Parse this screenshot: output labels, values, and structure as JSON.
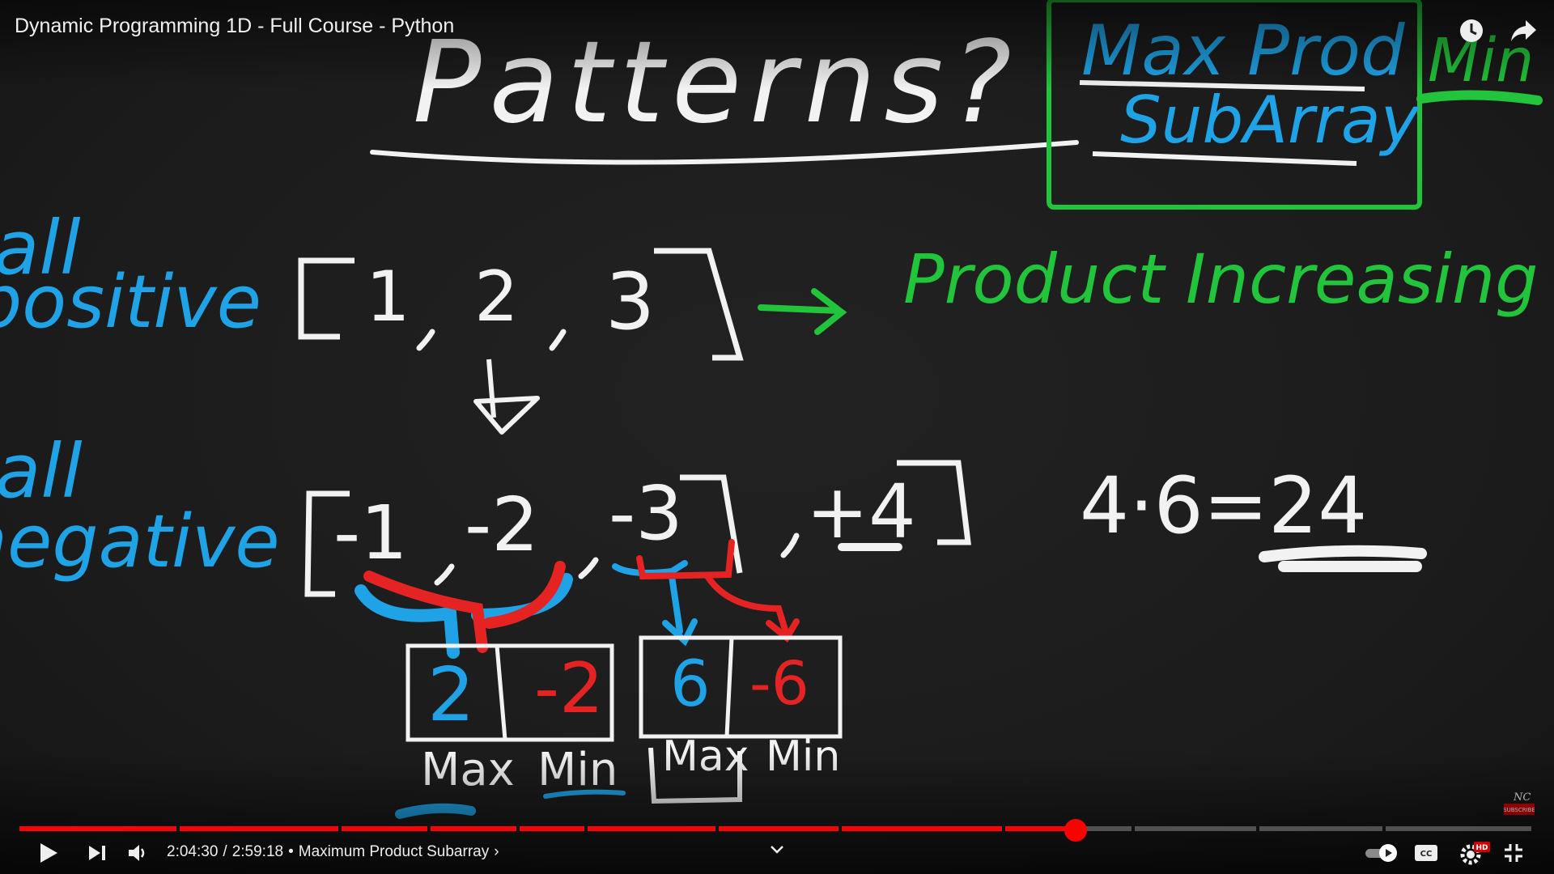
{
  "player": {
    "title": "Dynamic Programming 1D - Full Course - Python",
    "progress_fraction": 0.697,
    "current_time": "2:04:30",
    "duration": "2:59:18",
    "separator": "/",
    "bullet": "•",
    "chapter": "Maximum Product Subarray",
    "chapter_arrow": "›",
    "accent_color": "#ff0000"
  },
  "icons": {
    "watch_later": "clock-icon",
    "share": "share-icon",
    "play": "play-icon",
    "next": "next-icon",
    "volume": "volume-icon",
    "expand": "chevron-down-icon",
    "autoplay": "autoplay-toggle",
    "captions": "cc-icon",
    "settings": "gear-icon",
    "exit_fullscreen": "exit-fullscreen-icon"
  },
  "badges": {
    "settings_hd": "HD",
    "subscribe": "SUBSCRIBE",
    "channel_mark": "NC"
  },
  "board": {
    "heading": "Patterns?",
    "box_title_line1": "Max Prod",
    "box_title_line2": "SubArray",
    "min_note": "Min",
    "all_positive_1": "all",
    "all_positive_2": "positive",
    "all_negative_1": "all",
    "all_negative_2": "negative",
    "pos_array_open": "[",
    "pos_array_1": "1",
    "pos_array_2": "2",
    "pos_array_3": "3",
    "pos_array_close": "]",
    "product_increasing": "Product Increasing",
    "neg_array_open": "[",
    "neg_array_1": "-1",
    "neg_array_2": "-2",
    "neg_array_3": "-3",
    "neg_array_4": "+4",
    "neg_array_close": "]",
    "equation": "4·6=24",
    "cell_max_a": "2",
    "cell_min_a": "-2",
    "cell_max_b": "6",
    "cell_min_b": "-6",
    "label_max_a": "Max",
    "label_min_a": "Min",
    "label_max_b": "Max",
    "label_min_b": "Min",
    "colors": {
      "white": "#f2f2f2",
      "blue": "#1fa3e6",
      "green": "#21c43a",
      "red": "#e52323"
    }
  }
}
